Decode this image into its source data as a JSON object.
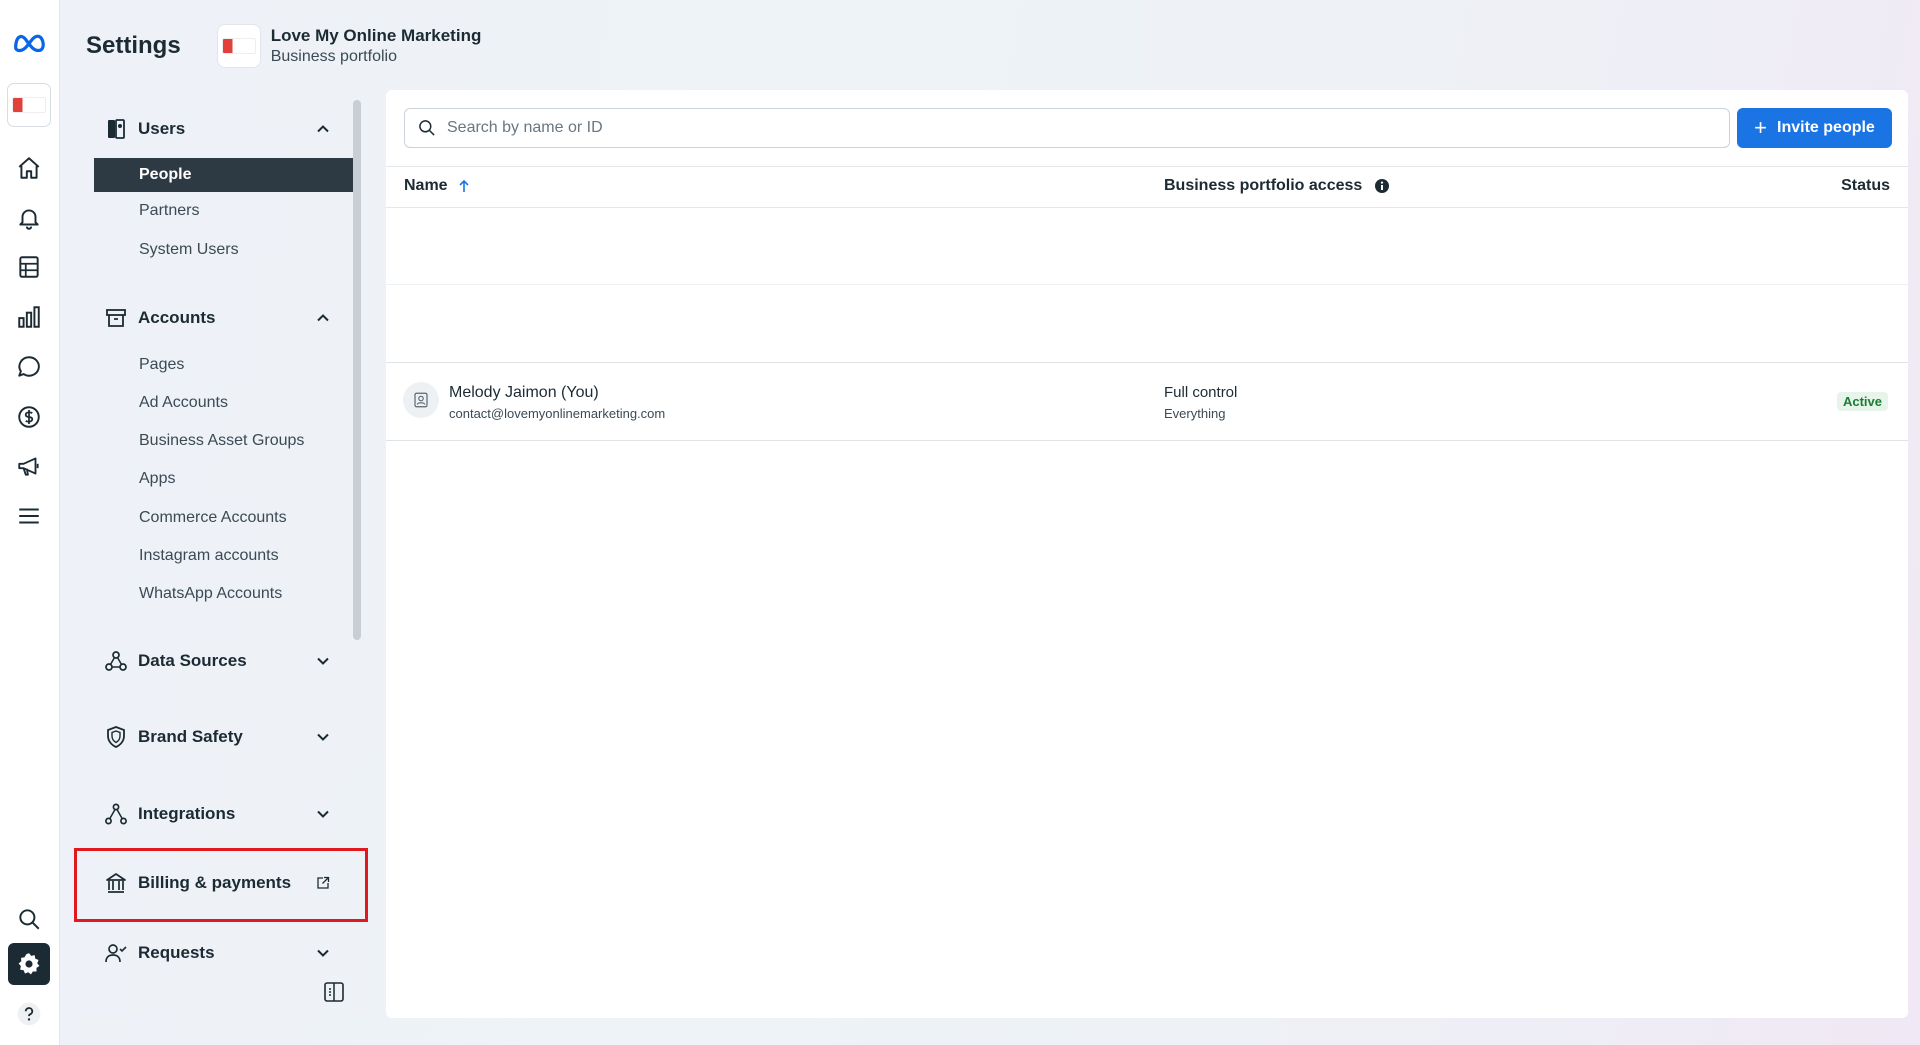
{
  "app": {
    "title": "Settings"
  },
  "portfolio": {
    "name": "Love My Online Marketing",
    "subtitle": "Business portfolio"
  },
  "rail": {
    "icons": [
      "meta-logo-icon",
      "business-logo",
      "home-icon",
      "bell-icon",
      "pages-icon",
      "bar-chart-icon",
      "chat-icon",
      "dollar-icon",
      "megaphone-icon",
      "menu-icon",
      "search-icon",
      "gear-icon",
      "help-icon"
    ]
  },
  "sidebar": {
    "users": {
      "label": "Users",
      "items": [
        "People",
        "Partners",
        "System Users"
      ]
    },
    "accounts": {
      "label": "Accounts",
      "items": [
        "Pages",
        "Ad Accounts",
        "Business Asset Groups",
        "Apps",
        "Commerce Accounts",
        "Instagram accounts",
        "WhatsApp Accounts"
      ]
    },
    "data_sources": {
      "label": "Data Sources"
    },
    "brand_safety": {
      "label": "Brand Safety"
    },
    "integrations": {
      "label": "Integrations"
    },
    "billing": {
      "label": "Billing & payments"
    },
    "requests": {
      "label": "Requests"
    }
  },
  "main": {
    "search_placeholder": "Search by name or ID",
    "invite_label": "Invite people",
    "columns": {
      "name": "Name",
      "access": "Business portfolio access",
      "status": "Status"
    },
    "rows": [
      {
        "name": "Melody Jaimon (You)",
        "email": "contact@lovemyonlinemarketing.com",
        "access": "Full control",
        "access_detail": "Everything",
        "status": "Active"
      }
    ]
  },
  "colors": {
    "accent": "#1b74e4",
    "active_nav": "#2d3a43",
    "highlight": "#e0191e",
    "status_active": "#1e7b34"
  }
}
